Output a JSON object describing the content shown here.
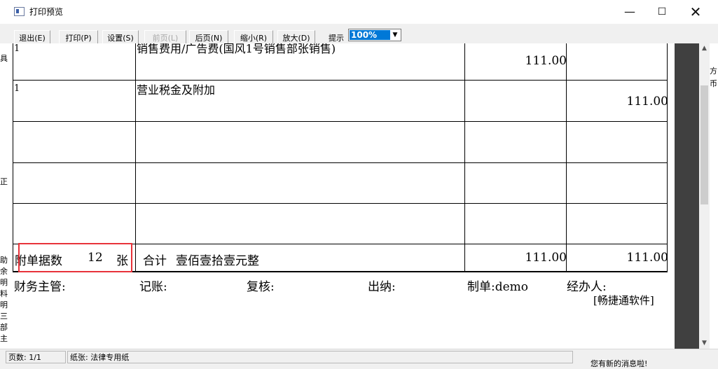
{
  "window": {
    "title": "打印预览"
  },
  "toolbar": {
    "buttons": [
      {
        "label": "退出(E)",
        "enabled": true
      },
      {
        "label": "打印(P)",
        "enabled": true
      },
      {
        "label": "设置(S)",
        "enabled": true
      },
      {
        "label": "前页(L)",
        "enabled": false
      },
      {
        "label": "后页(N)",
        "enabled": true
      },
      {
        "label": "缩小(R)",
        "enabled": true
      },
      {
        "label": "放大(D)",
        "enabled": true
      }
    ],
    "hint_label": "提示",
    "zoom": "100%"
  },
  "voucher": {
    "rows": [
      {
        "col1": "1",
        "summary": "销售费用/广告费(国风1号销售部张销售)",
        "debit": "111.00",
        "credit": ""
      },
      {
        "col1": "1",
        "summary": "营业税金及附加",
        "debit": "",
        "credit": "111.00"
      },
      {
        "col1": "",
        "summary": "",
        "debit": "",
        "credit": ""
      },
      {
        "col1": "",
        "summary": "",
        "debit": "",
        "credit": ""
      },
      {
        "col1": "",
        "summary": "",
        "debit": "",
        "credit": ""
      }
    ],
    "attachments_label": "附单据数",
    "attachments_count": "12",
    "attachments_unit": "张",
    "total_label": "合计",
    "total_words": "壹佰壹拾壹元整",
    "total_debit": "111.00",
    "total_credit": "111.00",
    "signatures": {
      "finance_supervisor": "财务主管:",
      "bookkeeper": "记账:",
      "reviewer": "复核:",
      "cashier": "出纳:",
      "preparer": "制单:demo",
      "handler": "经办人:"
    },
    "software_brand": "[畅捷通软件]"
  },
  "status": {
    "page": "页数: 1/1",
    "paper": "纸张: 法律专用纸"
  },
  "background_fragments": {
    "left": [
      "具",
      "正",
      "助",
      "余",
      "明",
      "料",
      "明",
      "三",
      "部",
      "主"
    ],
    "right": [
      "方",
      "币"
    ],
    "bottom": "您有新的消息啦!"
  },
  "colors": {
    "highlight": "#e8333a",
    "zoom_selected": "#0078d7",
    "viewport_dark": "#404040"
  }
}
